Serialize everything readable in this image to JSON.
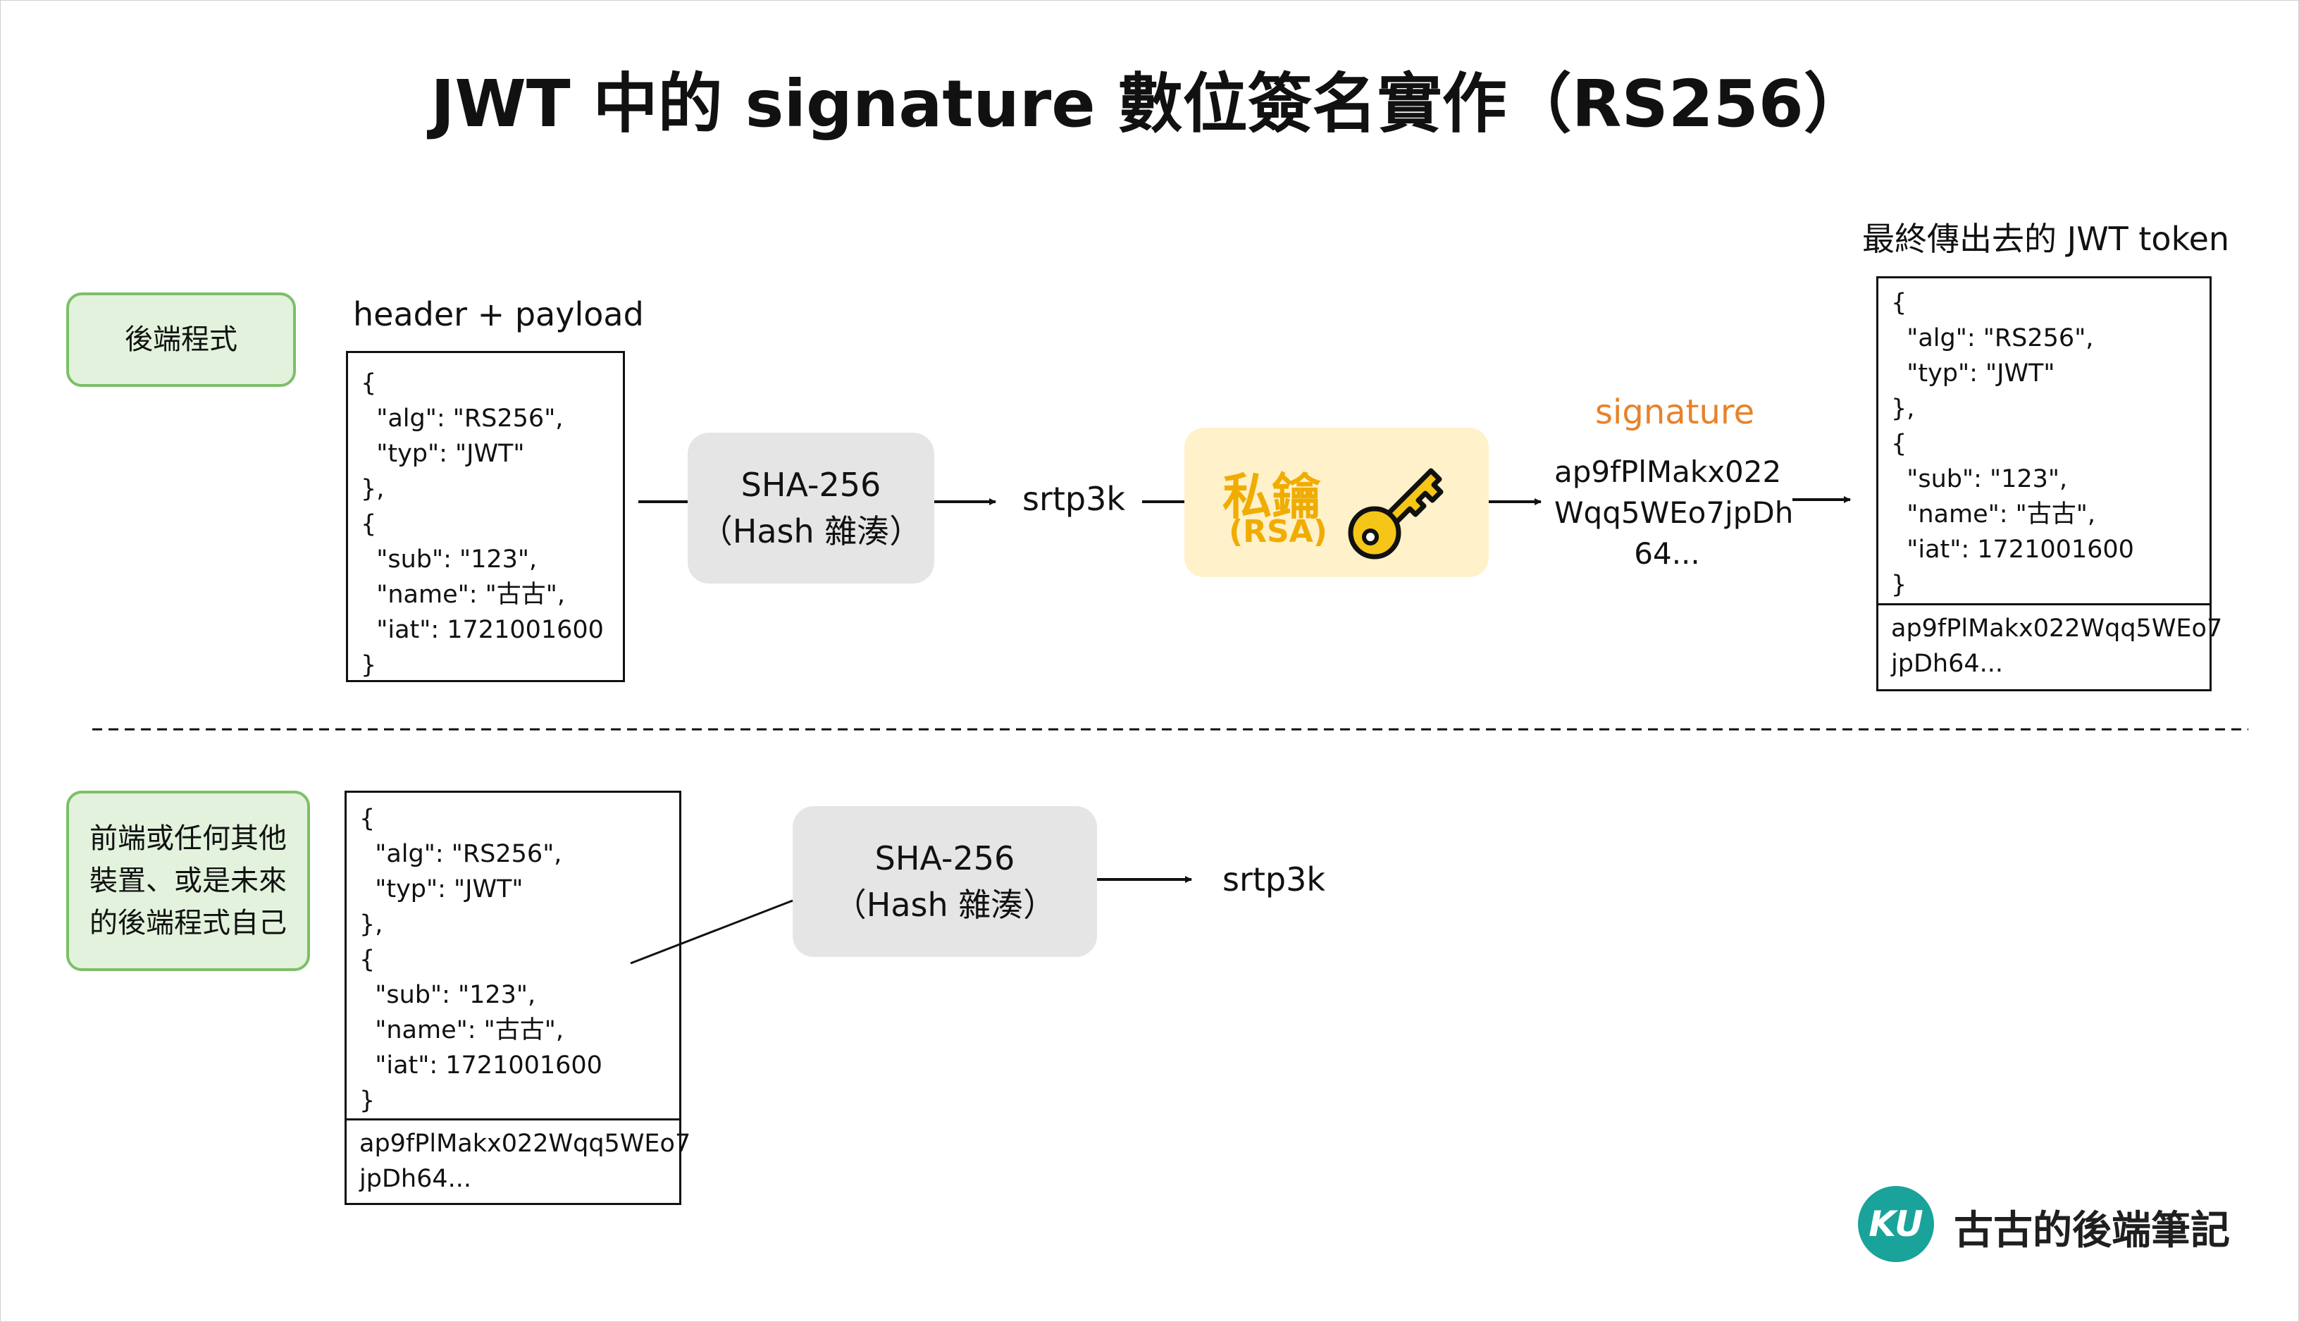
{
  "title": "JWT 中的 signature 數位簽名實作（RS256）",
  "backend": {
    "role_label": "後端程式",
    "input_label": "header + payload",
    "json_lines": [
      "{",
      "  \"alg\": \"RS256\",",
      "  \"typ\": \"JWT\"",
      "},",
      "{",
      "  \"sub\": \"123\",",
      "  \"name\": \"古古\",",
      "  \"iat\": 1721001600",
      "}"
    ],
    "hash_box": {
      "line1": "SHA-256",
      "line2": "（Hash 雜湊）"
    },
    "hash_output": "srtp3k",
    "private_key": {
      "title": "私鑰",
      "subtitle": "(RSA)",
      "icon": "key-icon"
    },
    "signature_label": "signature",
    "signature_value_lines": [
      "ap9fPlMakx022",
      "Wqq5WEo7jpDh",
      "64..."
    ],
    "token_label": "最終傳出去的 JWT token",
    "token_json_lines": [
      "{",
      "  \"alg\": \"RS256\",",
      "  \"typ\": \"JWT\"",
      "},",
      "{",
      "  \"sub\": \"123\",",
      "  \"name\": \"古古\",",
      "  \"iat\": 1721001600",
      "}"
    ],
    "token_signature_lines": [
      "ap9fPlMakx022Wqq5WEo7",
      "jpDh64..."
    ]
  },
  "verifier": {
    "role_lines": [
      "前端或任何其他",
      "裝置、或是未來",
      "的後端程式自己"
    ],
    "json_lines": [
      "{",
      "  \"alg\": \"RS256\",",
      "  \"typ\": \"JWT\"",
      "},",
      "{",
      "  \"sub\": \"123\",",
      "  \"name\": \"古古\",",
      "  \"iat\": 1721001600",
      "}"
    ],
    "signature_lines": [
      "ap9fPlMakx022Wqq5WEo7",
      "jpDh64..."
    ],
    "hash_box": {
      "line1": "SHA-256",
      "line2": "（Hash 雜湊）"
    },
    "hash_output": "srtp3k"
  },
  "brand": {
    "logo_text": "KU",
    "name": "古古的後端筆記",
    "logo_color": "#1aa39a"
  },
  "colors": {
    "role_fill": "#e2f2dc",
    "role_border": "#7cbf68",
    "hash_fill": "#e5e5e5",
    "key_fill": "#fff1c9",
    "key_accent": "#f0ac00",
    "signature_label": "#e8822a"
  }
}
